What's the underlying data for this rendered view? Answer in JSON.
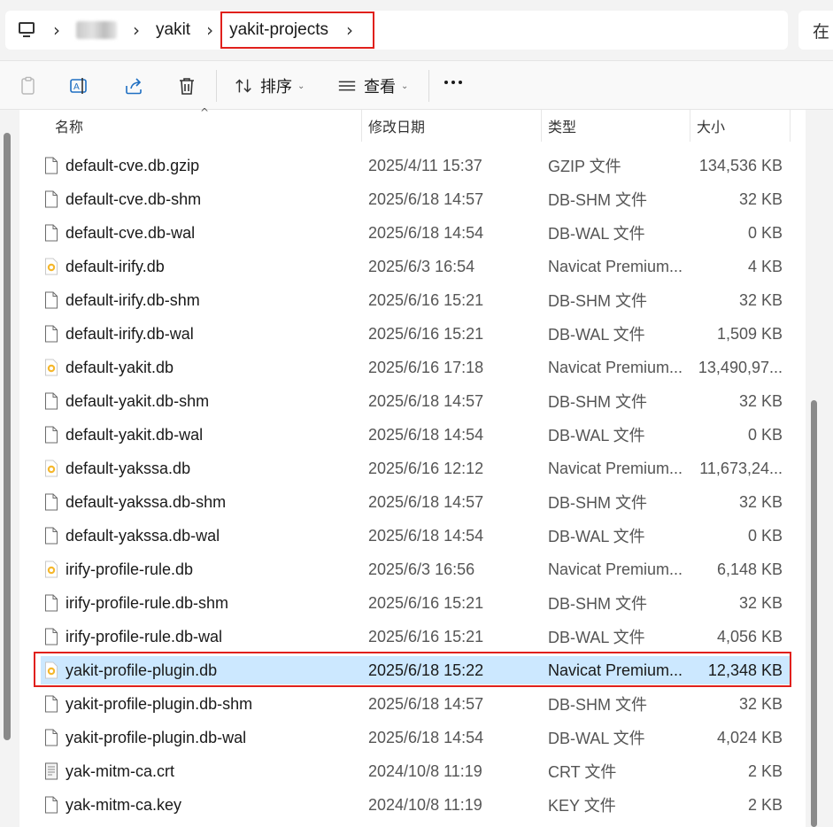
{
  "breadcrumb": {
    "items": [
      "yakit",
      "yakit-projects"
    ],
    "search_partial": "在"
  },
  "toolbar": {
    "sort_label": "排序",
    "view_label": "查看"
  },
  "columns": {
    "name": "名称",
    "modified": "修改日期",
    "type": "类型",
    "size": "大小"
  },
  "files": [
    {
      "name": "default-cve.db.gzip",
      "modified": "2025/4/11 15:37",
      "type": "GZIP 文件",
      "size": "134,536 KB",
      "icon": "generic-file-icon"
    },
    {
      "name": "default-cve.db-shm",
      "modified": "2025/6/18 14:57",
      "type": "DB-SHM 文件",
      "size": "32 KB",
      "icon": "generic-file-icon"
    },
    {
      "name": "default-cve.db-wal",
      "modified": "2025/6/18 14:54",
      "type": "DB-WAL 文件",
      "size": "0 KB",
      "icon": "generic-file-icon"
    },
    {
      "name": "default-irify.db",
      "modified": "2025/6/3 16:54",
      "type": "Navicat Premium...",
      "size": "4 KB",
      "icon": "navicat-db-icon"
    },
    {
      "name": "default-irify.db-shm",
      "modified": "2025/6/16 15:21",
      "type": "DB-SHM 文件",
      "size": "32 KB",
      "icon": "generic-file-icon"
    },
    {
      "name": "default-irify.db-wal",
      "modified": "2025/6/16 15:21",
      "type": "DB-WAL 文件",
      "size": "1,509 KB",
      "icon": "generic-file-icon"
    },
    {
      "name": "default-yakit.db",
      "modified": "2025/6/16 17:18",
      "type": "Navicat Premium...",
      "size": "13,490,97...",
      "icon": "navicat-db-icon"
    },
    {
      "name": "default-yakit.db-shm",
      "modified": "2025/6/18 14:57",
      "type": "DB-SHM 文件",
      "size": "32 KB",
      "icon": "generic-file-icon"
    },
    {
      "name": "default-yakit.db-wal",
      "modified": "2025/6/18 14:54",
      "type": "DB-WAL 文件",
      "size": "0 KB",
      "icon": "generic-file-icon"
    },
    {
      "name": "default-yakssa.db",
      "modified": "2025/6/16 12:12",
      "type": "Navicat Premium...",
      "size": "11,673,24...",
      "icon": "navicat-db-icon"
    },
    {
      "name": "default-yakssa.db-shm",
      "modified": "2025/6/18 14:57",
      "type": "DB-SHM 文件",
      "size": "32 KB",
      "icon": "generic-file-icon"
    },
    {
      "name": "default-yakssa.db-wal",
      "modified": "2025/6/18 14:54",
      "type": "DB-WAL 文件",
      "size": "0 KB",
      "icon": "generic-file-icon"
    },
    {
      "name": "irify-profile-rule.db",
      "modified": "2025/6/3 16:56",
      "type": "Navicat Premium...",
      "size": "6,148 KB",
      "icon": "navicat-db-icon"
    },
    {
      "name": "irify-profile-rule.db-shm",
      "modified": "2025/6/16 15:21",
      "type": "DB-SHM 文件",
      "size": "32 KB",
      "icon": "generic-file-icon"
    },
    {
      "name": "irify-profile-rule.db-wal",
      "modified": "2025/6/16 15:21",
      "type": "DB-WAL 文件",
      "size": "4,056 KB",
      "icon": "generic-file-icon"
    },
    {
      "name": "yakit-profile-plugin.db",
      "modified": "2025/6/18 15:22",
      "type": "Navicat Premium...",
      "size": "12,348 KB",
      "icon": "navicat-db-icon",
      "selected": true
    },
    {
      "name": "yakit-profile-plugin.db-shm",
      "modified": "2025/6/18 14:57",
      "type": "DB-SHM 文件",
      "size": "32 KB",
      "icon": "generic-file-icon"
    },
    {
      "name": "yakit-profile-plugin.db-wal",
      "modified": "2025/6/18 14:54",
      "type": "DB-WAL 文件",
      "size": "4,024 KB",
      "icon": "generic-file-icon"
    },
    {
      "name": "yak-mitm-ca.crt",
      "modified": "2024/10/8 11:19",
      "type": "CRT 文件",
      "size": "2 KB",
      "icon": "certificate-file-icon"
    },
    {
      "name": "yak-mitm-ca.key",
      "modified": "2024/10/8 11:19",
      "type": "KEY 文件",
      "size": "2 KB",
      "icon": "generic-file-icon"
    }
  ],
  "colors": {
    "selection": "#cce8ff",
    "highlight_border": "#e0201c",
    "navicat_icon": "#f5b82e"
  }
}
